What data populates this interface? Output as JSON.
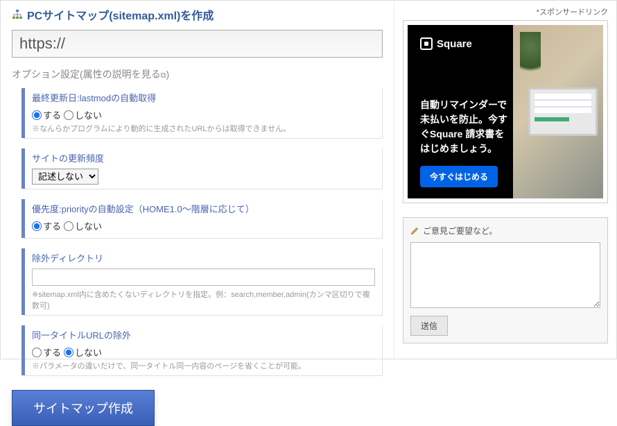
{
  "header": {
    "title": "PCサイトマップ(sitemap.xml)を作成"
  },
  "url_input": {
    "value": "https://"
  },
  "options_label": "オプション設定(属性の説明を見る",
  "options_label_suffix": ")",
  "sections": {
    "lastmod": {
      "legend": "最終更新日:lastmodの自動取得",
      "opt_yes": "する",
      "opt_no": "しない",
      "note": "※なんらかプログラムにより動的に生成されたURLからは取得できません。"
    },
    "freq": {
      "legend": "サイトの更新頻度",
      "selected": "記述しない"
    },
    "priority": {
      "legend": "優先度:priorityの自動設定（HOME1.0～階層に応じて）",
      "opt_yes": "する",
      "opt_no": "しない"
    },
    "exclude": {
      "legend": "除外ディレクトリ",
      "value": "",
      "note": "※sitemap.xml内に含めたくないディレクトリを指定。例：search,member,admin(カンマ区切りで複数可)"
    },
    "sametitle": {
      "legend": "同一タイトルURLの除外",
      "opt_yes": "する",
      "opt_no": "しない",
      "note": "※パラメータの違いだけで、同一タイトル同一内容のページを省くことが可能。"
    }
  },
  "submit_label": "サイトマップ作成",
  "sidebar": {
    "sponsor_label": "*スポンサードリンク",
    "ad": {
      "brand": "Square",
      "text": "自動リマインダーで未払いを防止。今すぐSquare 請求書をはじめましょう。",
      "cta": "今すぐはじめる"
    },
    "feedback": {
      "title": "ご意見ご要望など。",
      "send": "送信"
    }
  }
}
